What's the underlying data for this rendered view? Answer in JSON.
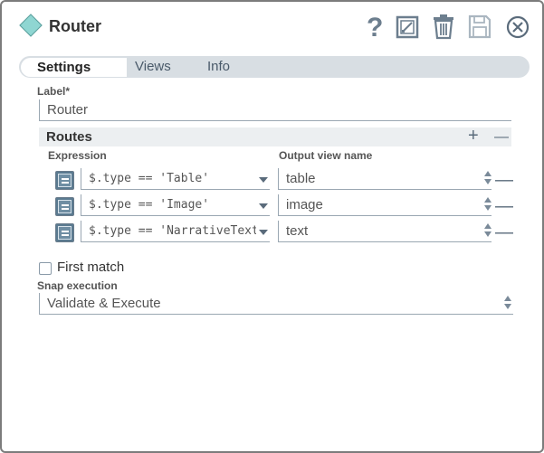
{
  "window": {
    "title": "Router",
    "icon": "diamond-icon",
    "toolbar": [
      "help-icon",
      "export-icon",
      "delete-icon",
      "save-icon",
      "close-icon"
    ]
  },
  "tabs": [
    {
      "label": "Settings",
      "active": true
    },
    {
      "label": "Views",
      "active": false
    },
    {
      "label": "Info",
      "active": false
    }
  ],
  "label_field": {
    "label": "Label*",
    "value": "Router"
  },
  "routes": {
    "title": "Routes",
    "add_symbol": "+",
    "remove_symbol": "—",
    "expression_header": "Expression",
    "output_header": "Output view name",
    "rows": [
      {
        "expression": "$.type == 'Table'",
        "output": "table"
      },
      {
        "expression": "$.type == 'Image'",
        "output": "image"
      },
      {
        "expression": "$.type == 'NarrativeText'",
        "output": "text"
      }
    ]
  },
  "first_match": {
    "label": "First match",
    "checked": false
  },
  "snap_execution": {
    "label": "Snap execution",
    "value": "Validate & Execute"
  },
  "colors": {
    "accent_diamond": "#8fd6d2",
    "tab_bar": "#d8dee3",
    "routes_bar": "#eceff1"
  }
}
